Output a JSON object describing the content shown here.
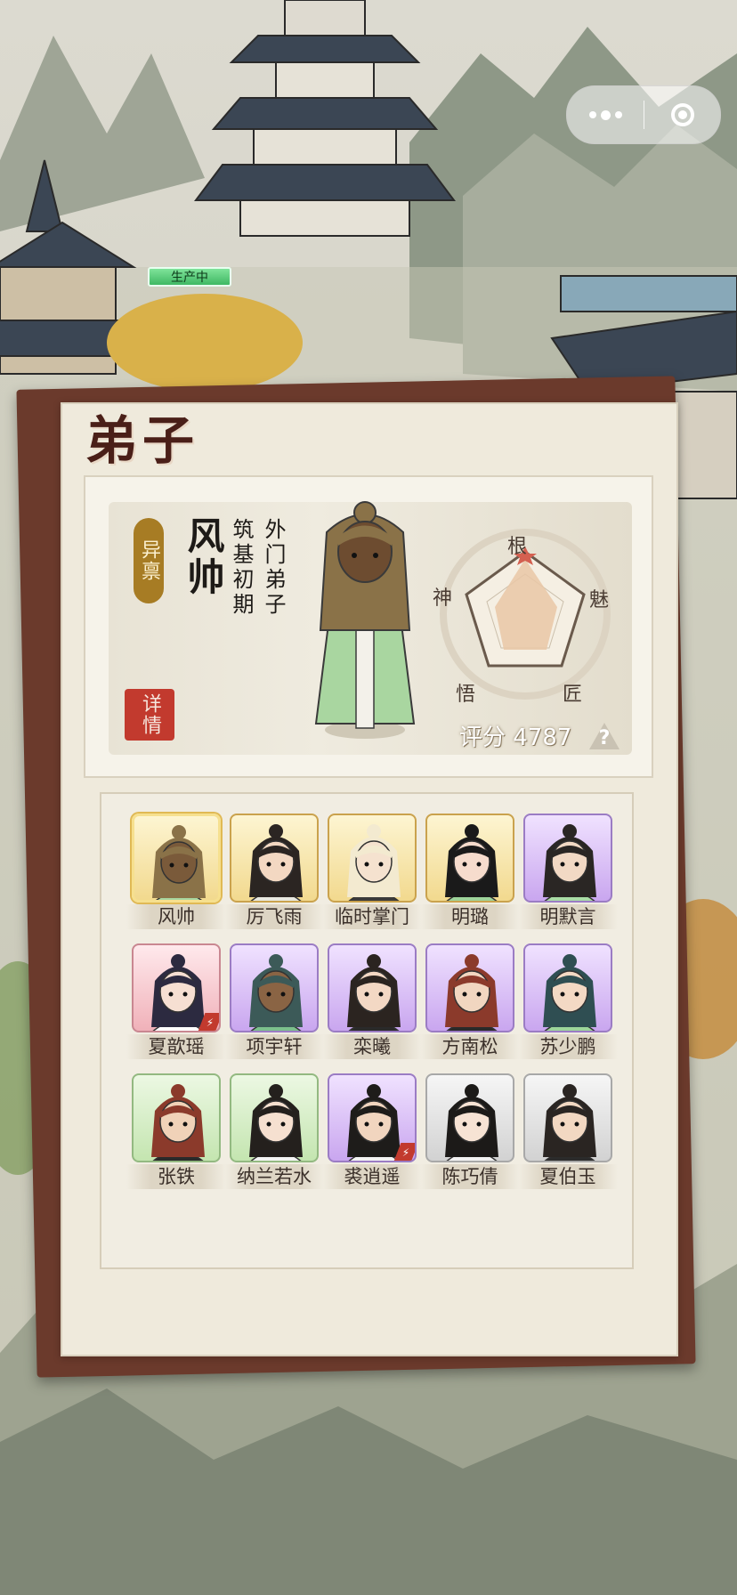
{
  "capsule": {
    "more_icon": "more-dots-icon",
    "close_icon": "target-close-icon"
  },
  "building_status": "生产中",
  "panel": {
    "title": "弟子"
  },
  "profile": {
    "tag": "异禀",
    "name": "风帅",
    "realm": "筑基初期",
    "rank": "外门弟子",
    "detail_seal": "详情",
    "score_text": "评分 4787",
    "help_label": "?",
    "stats": {
      "top": "根",
      "right": "魅",
      "bottom_right": "匠",
      "bottom_left": "悟",
      "left": "神"
    },
    "colors": {
      "radar_fill": "#e9c7a6",
      "seal_red": "#c23a2e"
    }
  },
  "disciples": [
    {
      "name": "风帅",
      "rarity": "gold",
      "selected": true,
      "hair": "#8a7248",
      "skin": "#7a5a3a",
      "robe": "#a8d6a0"
    },
    {
      "name": "厉飞雨",
      "rarity": "gold",
      "hair": "#2b2522",
      "skin": "#f3d8c2",
      "robe": "#e8e8e0"
    },
    {
      "name": "临时掌门",
      "rarity": "gold",
      "hair": "#f3ead0",
      "skin": "#f5e2cf",
      "robe": "#3a3a3a"
    },
    {
      "name": "明璐",
      "rarity": "gold",
      "hair": "#1a1a1a",
      "skin": "#f6dccd",
      "robe": "#9ed49a"
    },
    {
      "name": "明默言",
      "rarity": "purple",
      "hair": "#2a2624",
      "skin": "#f2d9c4",
      "robe": "#a9dca6"
    },
    {
      "name": "夏歆瑶",
      "rarity": "red",
      "hair": "#2c2a40",
      "skin": "#f6dfd2",
      "robe": "#ffffff",
      "mark": true
    },
    {
      "name": "项宇轩",
      "rarity": "purple",
      "hair": "#3c5a58",
      "skin": "#8a6444",
      "robe": "#7cc08c"
    },
    {
      "name": "栾曦",
      "rarity": "purple",
      "hair": "#2b2420",
      "skin": "#f3d8c4",
      "robe": "#2a2a2a"
    },
    {
      "name": "方南松",
      "rarity": "purple",
      "hair": "#8b3a2b",
      "skin": "#f1d6c0",
      "robe": "#2a2a2a"
    },
    {
      "name": "苏少鹏",
      "rarity": "purple",
      "hair": "#2f4e52",
      "skin": "#f3d9c4",
      "robe": "#9dd59a"
    },
    {
      "name": "张铁",
      "rarity": "green",
      "hair": "#8b3a2b",
      "skin": "#f0d2b8",
      "robe": "#2a2a2a"
    },
    {
      "name": "纳兰若水",
      "rarity": "green",
      "hair": "#24201d",
      "skin": "#f6e0d0",
      "robe": "#f4f4f4"
    },
    {
      "name": "裘逍遥",
      "rarity": "purple",
      "hair": "#1e1c1a",
      "skin": "#f1d5bf",
      "robe": "#f3f3f3",
      "mark": true
    },
    {
      "name": "陈巧倩",
      "rarity": "gray",
      "hair": "#1c1a18",
      "skin": "#f7e3d4",
      "robe": "#f2f2f2"
    },
    {
      "name": "夏伯玉",
      "rarity": "gray",
      "hair": "#2a2522",
      "skin": "#f2d8c2",
      "robe": "#2b2b2b"
    }
  ]
}
